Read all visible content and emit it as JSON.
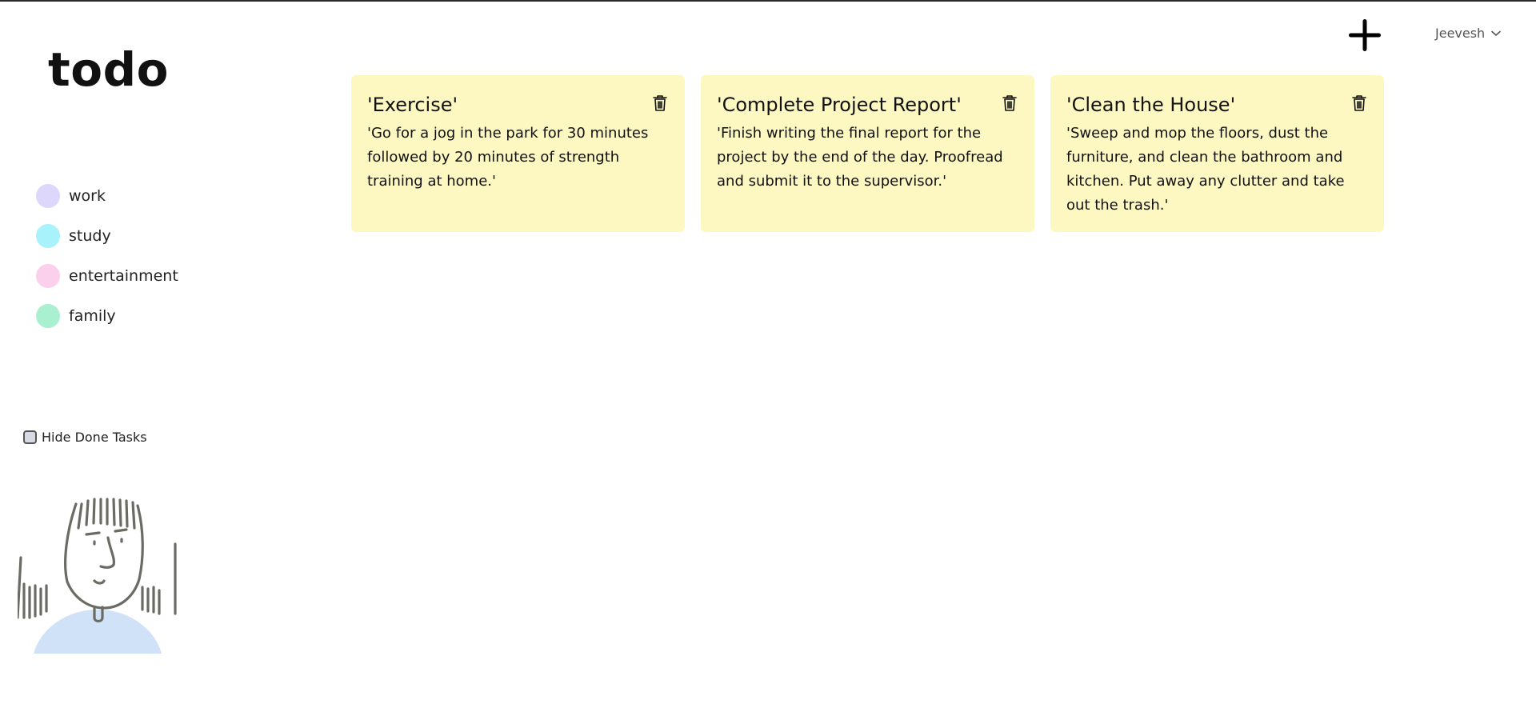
{
  "app": {
    "title": "todo"
  },
  "header": {
    "add_icon": "plus-icon",
    "user": {
      "name": "Jeevesh",
      "icon": "chevron-down-icon"
    }
  },
  "sidebar": {
    "categories": [
      {
        "label": "work",
        "color": "#ddd7fc"
      },
      {
        "label": "study",
        "color": "#a8f2fb"
      },
      {
        "label": "entertainment",
        "color": "#fbd0ec"
      },
      {
        "label": "family",
        "color": "#a9f0d0"
      }
    ],
    "hide_done": {
      "label": "Hide Done Tasks",
      "checked": false
    }
  },
  "tasks": [
    {
      "title": "'Exercise'",
      "description": "'Go for a jog in the park for 30 minutes followed by 20 minutes of strength training at home.'",
      "icon": "trash-icon"
    },
    {
      "title": "'Complete Project Report'",
      "description": "'Finish writing the final report for the project by the end of the day. Proofread and submit it to the supervisor.'",
      "icon": "trash-icon"
    },
    {
      "title": "'Clean the House'",
      "description": "'Sweep and mop the floors, dust the furniture, and clean the bathroom and kitchen. Put away any clutter and take out the trash.'",
      "icon": "trash-icon"
    }
  ],
  "colors": {
    "card_bg": "#fdf7c1",
    "page_bg": "#ffffff"
  }
}
